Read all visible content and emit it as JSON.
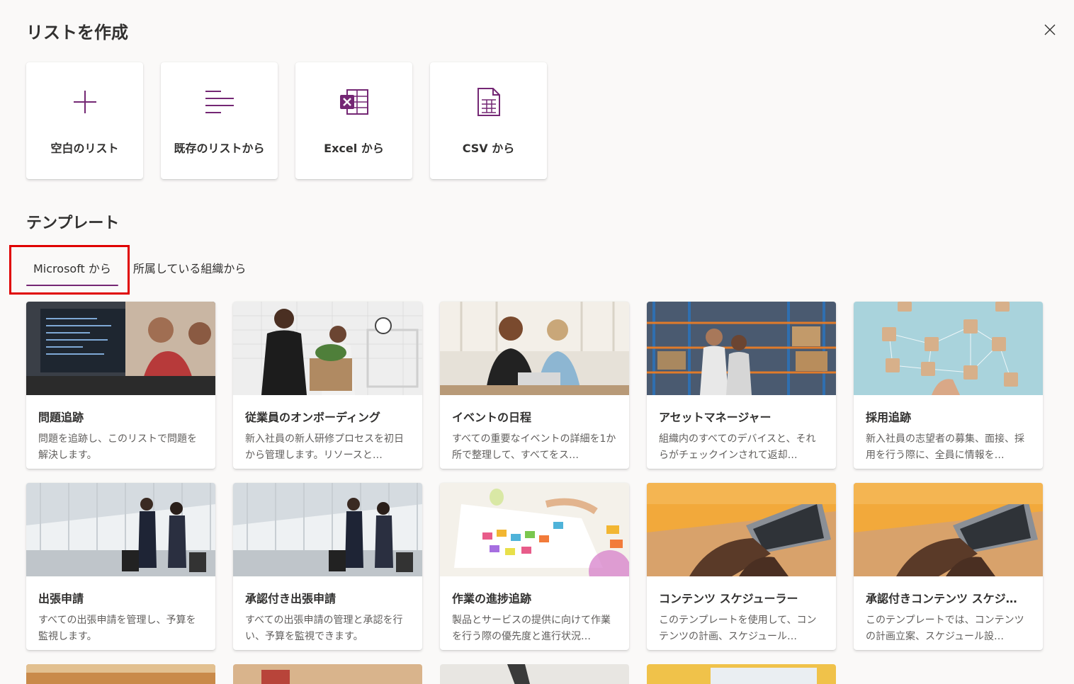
{
  "header": {
    "title": "リストを作成",
    "close_icon": "close-icon"
  },
  "create_options": [
    {
      "id": "blank",
      "label": "空白のリスト",
      "icon": "plus-icon"
    },
    {
      "id": "existing",
      "label": "既存のリストから",
      "icon": "list-lines-icon"
    },
    {
      "id": "excel",
      "label": "Excel から",
      "icon": "excel-icon"
    },
    {
      "id": "csv",
      "label": "CSV から",
      "icon": "csv-file-icon"
    }
  ],
  "templates": {
    "heading": "テンプレート",
    "tabs": [
      {
        "label": "Microsoft から",
        "active": true
      },
      {
        "label": "所属している組織から",
        "active": false
      }
    ],
    "cards": [
      {
        "title": "問題追跡",
        "desc": "問題を追跡し、このリストで問題を解決します。"
      },
      {
        "title": "従業員のオンボーディング",
        "desc": "新入社員の新人研修プロセスを初日から管理します。リソースと…"
      },
      {
        "title": "イベントの日程",
        "desc": "すべての重要なイベントの詳細を1か所で整理して、すべてをス…"
      },
      {
        "title": "アセットマネージャー",
        "desc": "組織内のすべてのデバイスと、それらがチェックインされて返却…"
      },
      {
        "title": "採用追跡",
        "desc": "新入社員の志望者の募集、面接、採用を行う際に、全員に情報を…"
      },
      {
        "title": "出張申請",
        "desc": "すべての出張申請を管理し、予算を監視します。"
      },
      {
        "title": "承認付き出張申請",
        "desc": "すべての出張申請の管理と承認を行い、予算を監視できます。"
      },
      {
        "title": "作業の進捗追跡",
        "desc": "製品とサービスの提供に向けて作業を行う際の優先度と進行状況…"
      },
      {
        "title": "コンテンツ スケジューラー",
        "desc": "このテンプレートを使用して、コンテンツの計画、スケジュール…"
      },
      {
        "title": "承認付きコンテンツ スケジ…",
        "desc": "このテンプレートでは、コンテンツの計画立案、スケジュール設…"
      }
    ]
  },
  "colors": {
    "accent": "#742774",
    "highlight": "#e00000",
    "excel": "#742774"
  }
}
